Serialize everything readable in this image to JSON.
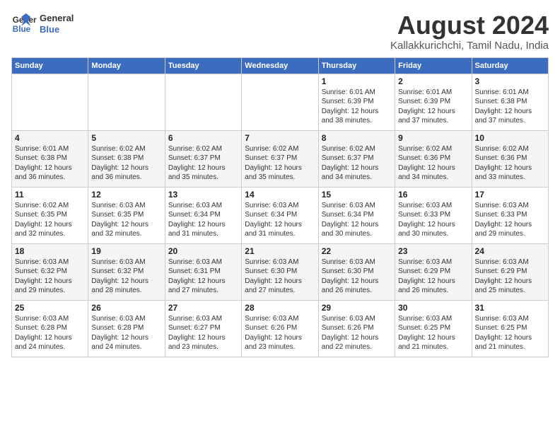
{
  "logo": {
    "line1": "General",
    "line2": "Blue"
  },
  "title": "August 2024",
  "subtitle": "Kallakkurichchi, Tamil Nadu, India",
  "days_of_week": [
    "Sunday",
    "Monday",
    "Tuesday",
    "Wednesday",
    "Thursday",
    "Friday",
    "Saturday"
  ],
  "weeks": [
    [
      {
        "day": "",
        "info": ""
      },
      {
        "day": "",
        "info": ""
      },
      {
        "day": "",
        "info": ""
      },
      {
        "day": "",
        "info": ""
      },
      {
        "day": "1",
        "info": "Sunrise: 6:01 AM\nSunset: 6:39 PM\nDaylight: 12 hours\nand 38 minutes."
      },
      {
        "day": "2",
        "info": "Sunrise: 6:01 AM\nSunset: 6:39 PM\nDaylight: 12 hours\nand 37 minutes."
      },
      {
        "day": "3",
        "info": "Sunrise: 6:01 AM\nSunset: 6:38 PM\nDaylight: 12 hours\nand 37 minutes."
      }
    ],
    [
      {
        "day": "4",
        "info": "Sunrise: 6:01 AM\nSunset: 6:38 PM\nDaylight: 12 hours\nand 36 minutes."
      },
      {
        "day": "5",
        "info": "Sunrise: 6:02 AM\nSunset: 6:38 PM\nDaylight: 12 hours\nand 36 minutes."
      },
      {
        "day": "6",
        "info": "Sunrise: 6:02 AM\nSunset: 6:37 PM\nDaylight: 12 hours\nand 35 minutes."
      },
      {
        "day": "7",
        "info": "Sunrise: 6:02 AM\nSunset: 6:37 PM\nDaylight: 12 hours\nand 35 minutes."
      },
      {
        "day": "8",
        "info": "Sunrise: 6:02 AM\nSunset: 6:37 PM\nDaylight: 12 hours\nand 34 minutes."
      },
      {
        "day": "9",
        "info": "Sunrise: 6:02 AM\nSunset: 6:36 PM\nDaylight: 12 hours\nand 34 minutes."
      },
      {
        "day": "10",
        "info": "Sunrise: 6:02 AM\nSunset: 6:36 PM\nDaylight: 12 hours\nand 33 minutes."
      }
    ],
    [
      {
        "day": "11",
        "info": "Sunrise: 6:02 AM\nSunset: 6:35 PM\nDaylight: 12 hours\nand 32 minutes."
      },
      {
        "day": "12",
        "info": "Sunrise: 6:03 AM\nSunset: 6:35 PM\nDaylight: 12 hours\nand 32 minutes."
      },
      {
        "day": "13",
        "info": "Sunrise: 6:03 AM\nSunset: 6:34 PM\nDaylight: 12 hours\nand 31 minutes."
      },
      {
        "day": "14",
        "info": "Sunrise: 6:03 AM\nSunset: 6:34 PM\nDaylight: 12 hours\nand 31 minutes."
      },
      {
        "day": "15",
        "info": "Sunrise: 6:03 AM\nSunset: 6:34 PM\nDaylight: 12 hours\nand 30 minutes."
      },
      {
        "day": "16",
        "info": "Sunrise: 6:03 AM\nSunset: 6:33 PM\nDaylight: 12 hours\nand 30 minutes."
      },
      {
        "day": "17",
        "info": "Sunrise: 6:03 AM\nSunset: 6:33 PM\nDaylight: 12 hours\nand 29 minutes."
      }
    ],
    [
      {
        "day": "18",
        "info": "Sunrise: 6:03 AM\nSunset: 6:32 PM\nDaylight: 12 hours\nand 29 minutes."
      },
      {
        "day": "19",
        "info": "Sunrise: 6:03 AM\nSunset: 6:32 PM\nDaylight: 12 hours\nand 28 minutes."
      },
      {
        "day": "20",
        "info": "Sunrise: 6:03 AM\nSunset: 6:31 PM\nDaylight: 12 hours\nand 27 minutes."
      },
      {
        "day": "21",
        "info": "Sunrise: 6:03 AM\nSunset: 6:30 PM\nDaylight: 12 hours\nand 27 minutes."
      },
      {
        "day": "22",
        "info": "Sunrise: 6:03 AM\nSunset: 6:30 PM\nDaylight: 12 hours\nand 26 minutes."
      },
      {
        "day": "23",
        "info": "Sunrise: 6:03 AM\nSunset: 6:29 PM\nDaylight: 12 hours\nand 26 minutes."
      },
      {
        "day": "24",
        "info": "Sunrise: 6:03 AM\nSunset: 6:29 PM\nDaylight: 12 hours\nand 25 minutes."
      }
    ],
    [
      {
        "day": "25",
        "info": "Sunrise: 6:03 AM\nSunset: 6:28 PM\nDaylight: 12 hours\nand 24 minutes."
      },
      {
        "day": "26",
        "info": "Sunrise: 6:03 AM\nSunset: 6:28 PM\nDaylight: 12 hours\nand 24 minutes."
      },
      {
        "day": "27",
        "info": "Sunrise: 6:03 AM\nSunset: 6:27 PM\nDaylight: 12 hours\nand 23 minutes."
      },
      {
        "day": "28",
        "info": "Sunrise: 6:03 AM\nSunset: 6:26 PM\nDaylight: 12 hours\nand 23 minutes."
      },
      {
        "day": "29",
        "info": "Sunrise: 6:03 AM\nSunset: 6:26 PM\nDaylight: 12 hours\nand 22 minutes."
      },
      {
        "day": "30",
        "info": "Sunrise: 6:03 AM\nSunset: 6:25 PM\nDaylight: 12 hours\nand 21 minutes."
      },
      {
        "day": "31",
        "info": "Sunrise: 6:03 AM\nSunset: 6:25 PM\nDaylight: 12 hours\nand 21 minutes."
      }
    ]
  ]
}
